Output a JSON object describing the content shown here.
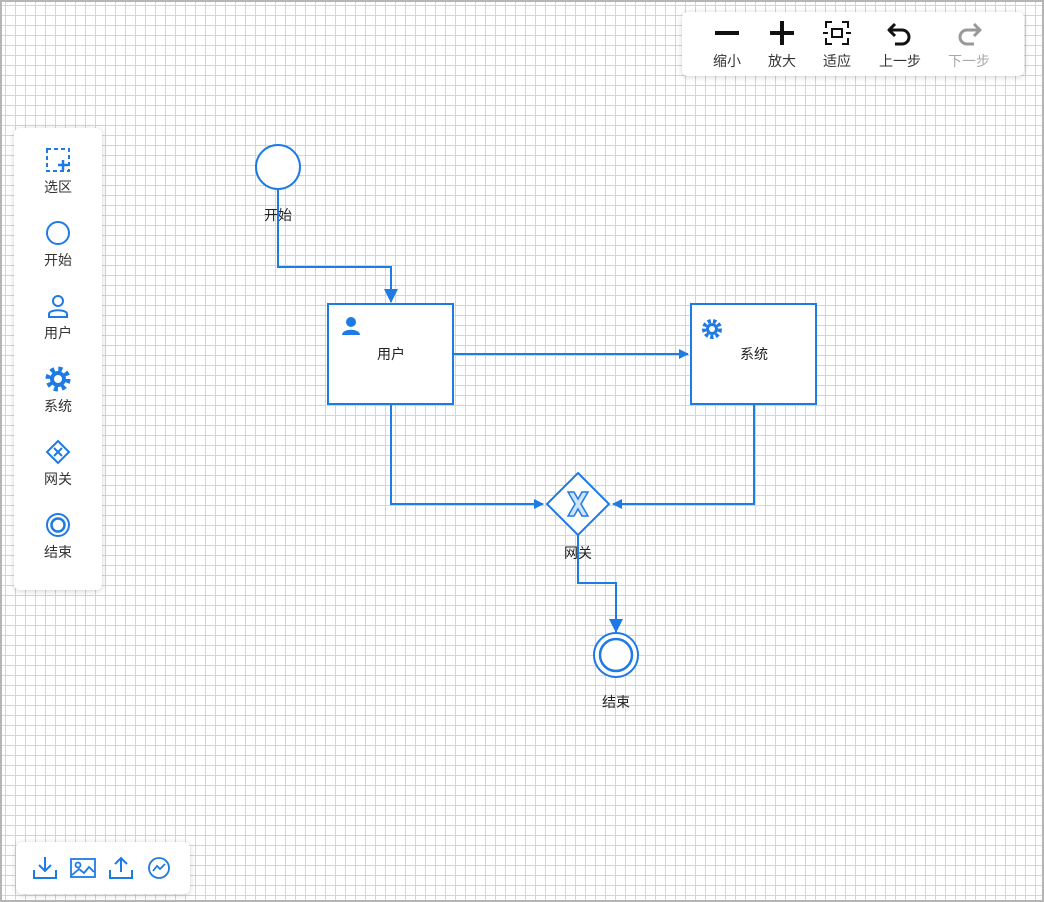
{
  "toolbar": {
    "items": [
      {
        "label": "缩小",
        "icon": "minus-icon",
        "enabled": true
      },
      {
        "label": "放大",
        "icon": "plus-icon",
        "enabled": true
      },
      {
        "label": "适应",
        "icon": "fit-icon",
        "enabled": true
      },
      {
        "label": "上一步",
        "icon": "undo-icon",
        "enabled": true
      },
      {
        "label": "下一步",
        "icon": "redo-icon",
        "enabled": false
      }
    ]
  },
  "palette": {
    "items": [
      {
        "label": "选区",
        "icon": "selection-icon"
      },
      {
        "label": "开始",
        "icon": "start-event-icon"
      },
      {
        "label": "用户",
        "icon": "user-task-icon"
      },
      {
        "label": "系统",
        "icon": "service-task-icon"
      },
      {
        "label": "网关",
        "icon": "gateway-icon"
      },
      {
        "label": "结束",
        "icon": "end-event-icon"
      }
    ]
  },
  "bottombar": {
    "items": [
      {
        "icon": "download-icon"
      },
      {
        "icon": "image-icon"
      },
      {
        "icon": "upload-icon"
      },
      {
        "icon": "chart-icon"
      }
    ]
  },
  "diagram": {
    "start_label": "开始",
    "user_task_label": "用户",
    "service_task_label": "系统",
    "gateway_label": "网关",
    "end_label": "结束"
  },
  "colors": {
    "accent": "#1e7be6",
    "grid": "#d4d4d4",
    "text": "#333333",
    "disabled_text": "#aaaaaa"
  }
}
